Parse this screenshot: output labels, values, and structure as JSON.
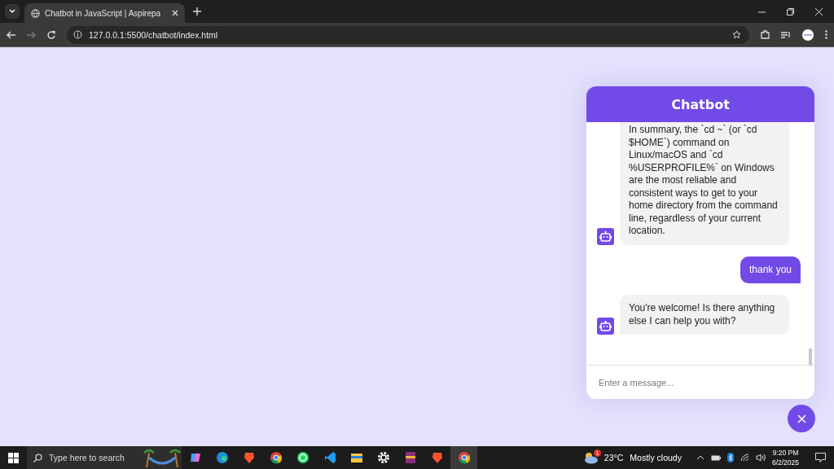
{
  "browser": {
    "tab_title": "Chatbot in JavaScript | Aspirepa",
    "url": "127.0.0.1:5500/chatbot/index.html"
  },
  "chatbot": {
    "title": "Chatbot",
    "messages": [
      {
        "kind": "bot",
        "text": "In summary, the `cd ~` (or `cd $HOME`) command on Linux/macOS and `cd %USERPROFILE%` on Windows are the most reliable and consistent ways to get to your home directory from the command line, regardless of your current location."
      },
      {
        "kind": "user",
        "text": "thank you"
      },
      {
        "kind": "bot",
        "text": "You're welcome! Is there anything else I can help you with?"
      }
    ],
    "input": {
      "placeholder": "Enter a message..."
    }
  },
  "taskbar": {
    "search": {
      "placeholder": "Type here to search"
    },
    "weather": {
      "badge": "1",
      "temperature": "23°C",
      "condition": "Mostly cloudy"
    },
    "time": "9:20 PM",
    "date": "6/2/2025"
  }
}
